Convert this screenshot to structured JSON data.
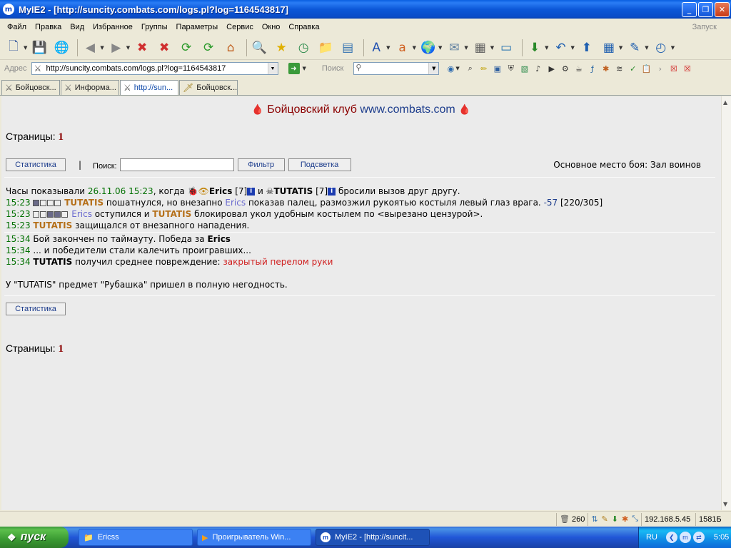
{
  "window": {
    "title": "MyIE2 - [http://suncity.combats.com/logs.pl?log=1164543817]",
    "app_icon": "myie2-icon"
  },
  "menu": {
    "items": [
      "Файл",
      "Правка",
      "Вид",
      "Избранное",
      "Группы",
      "Параметры",
      "Сервис",
      "Окно",
      "Справка"
    ],
    "launch": "Запуск"
  },
  "address": {
    "label": "Адрес",
    "url": "http://suncity.combats.com/logs.pl?log=1164543817",
    "search_label": "Поиск"
  },
  "tabs": [
    {
      "label": "Бойцовск...",
      "icon": "crossed-swords-icon",
      "active": false
    },
    {
      "label": "Информа...",
      "icon": "crossed-swords-icon",
      "active": false
    },
    {
      "label": "http://sun...",
      "icon": "crossed-swords-icon",
      "active": true
    },
    {
      "label": "Бойцовск...",
      "icon": "sword-icon",
      "active": false
    }
  ],
  "page": {
    "club_name": "Бойцовский клуб",
    "site": "www.combats.com",
    "pages_label": "Страницы:",
    "pages_num": "1",
    "stats_button": "Статистика",
    "search_label": "Поиск:",
    "filter_button": "Фильтр",
    "highlight_button": "Подсветка",
    "battle_place": "Основное место боя: Зал воинов"
  },
  "log": {
    "intro": {
      "prefix": "Часы показывали",
      "datetime": "26.11.06 15:23",
      "when": ", когда",
      "player1": "Erics",
      "player1_level": "[7]",
      "and": "и",
      "player2": "TUTATIS",
      "player2_level": "[7]",
      "suffix": "бросили вызов друг другу."
    },
    "line1": {
      "time": "15:23",
      "actor": "TUTATIS",
      "text1": "пошатнулся, но внезапно",
      "target": "Erics",
      "text2": "показав палец, размозжил рукоятью костыля левый глаз врага.",
      "damage": "-57",
      "hp": "[220/305]"
    },
    "line2": {
      "time": "15:23",
      "actor": "Erics",
      "text1": "оступился и",
      "target": "TUTATIS",
      "text2": "блокировал укол удобным костылем по <вырезано цензурой>."
    },
    "line3": {
      "time": "15:23",
      "actor": "TUTATIS",
      "text": "защищался от внезапного нападения."
    },
    "line4": {
      "time": "15:34",
      "text": "Бой закончен по таймауту. Победа за",
      "winner": "Erics"
    },
    "line5": {
      "time": "15:34",
      "text": "... и победители стали калечить проигравших..."
    },
    "line6": {
      "time": "15:34",
      "actor": "TUTATIS",
      "text": "получил среднее повреждение:",
      "injury": "закрытый перелом руки"
    },
    "item_broken": "У \"TUTATIS\" предмет \"Рубашка\" пришел в полную негодность."
  },
  "status": {
    "count": "260",
    "ip": "192.168.5.45",
    "size": "1581Б"
  },
  "taskbar": {
    "start": "пуск",
    "tasks": [
      {
        "label": "Ericss",
        "icon": "folder-icon",
        "active": false
      },
      {
        "label": "Проигрыватель Win...",
        "icon": "media-player-icon",
        "active": false
      },
      {
        "label": "MyIE2 - [http://suncit...",
        "icon": "myie2-icon",
        "active": true
      }
    ],
    "lang": "RU",
    "clock": "5:05"
  },
  "colors": {
    "club_red": "#8b0000",
    "link_blue": "#1c3c8c",
    "time_green": "#007000",
    "orange_player": "#b5701a",
    "blue_player": "#6a6acf",
    "injury_red": "#d02020"
  }
}
